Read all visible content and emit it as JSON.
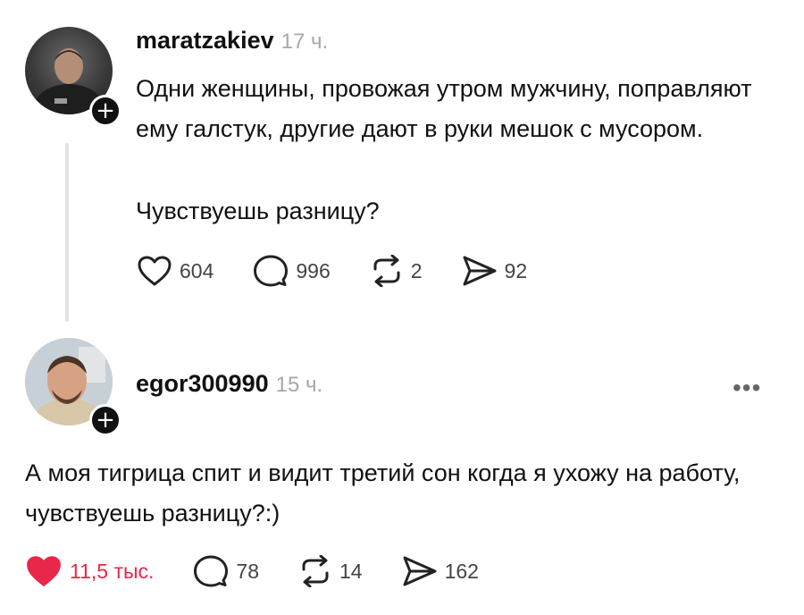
{
  "post": {
    "username": "maratzakiev",
    "time": "17 ч.",
    "paragraph_1": "Одни женщины, провожая утром мужчину, поправляют ему галстук, другие дают в руки мешок с мусором.",
    "paragraph_2": "Чувствуешь разницу?",
    "likes": "604",
    "comments": "996",
    "reposts": "2",
    "shares": "92"
  },
  "reply": {
    "username": "egor300990",
    "time": "15 ч.",
    "text": "А моя тигрица спит и видит третий сон когда я ухожу на работу, чувствуешь разницу?:)",
    "likes": "11,5 тыс.",
    "comments": "78",
    "reposts": "14",
    "shares": "162"
  },
  "icons": {
    "heart": "heart-icon",
    "heart_filled": "heart-filled-icon",
    "comment": "comment-icon",
    "repost": "repost-icon",
    "share": "share-icon",
    "follow": "plus-icon",
    "more": "more-icon"
  },
  "colors": {
    "like_active": "#e8274a",
    "meta_gray": "#a7a7a7"
  }
}
